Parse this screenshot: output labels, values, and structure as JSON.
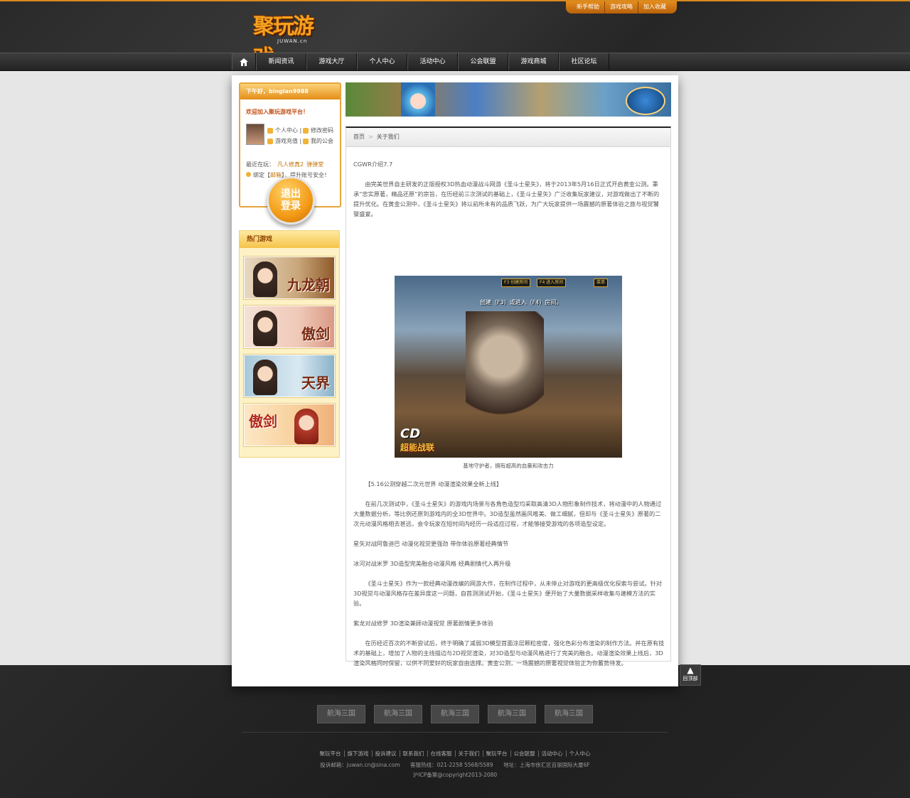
{
  "header": {
    "logo_text": "聚玩游戏",
    "logo_sub": "JUWAN.cn",
    "top_links": [
      "新手帮助",
      "游戏攻略",
      "加入收藏"
    ]
  },
  "nav": {
    "home_icon": "home-icon",
    "items": [
      "新闻资讯",
      "游戏大厅",
      "个人中心",
      "活动中心",
      "公会联盟",
      "游戏商城",
      "社区论坛"
    ]
  },
  "userbox": {
    "greeting": "下午好，binglan9988",
    "welcome": "欢迎加入聚玩游戏平台！",
    "links": [
      "个人中心",
      "修改密码",
      "游戏充值",
      "我的公会"
    ],
    "recent_label": "最近在玩：",
    "recent_games": [
      "凡人修真2",
      "弹弹堂"
    ],
    "bind_prefix": "绑定【",
    "bind_mail": "邮箱",
    "bind_suffix": "】，提升账号安全！",
    "logout_line1": "退出",
    "logout_line2": "登录"
  },
  "hotgames": {
    "title": "热门游戏",
    "games": [
      "九龙朝",
      "傲剑",
      "天界",
      "傲剑"
    ]
  },
  "breadcrumb": {
    "home": "首页",
    "current": "关于我们"
  },
  "article": {
    "p1": "CGWR介绍7.7",
    "p2": "由完美世界自主研发的正版授权3D热血动漫战斗网游《圣斗士星矢》，将于2013年5月16日正式开启黄金公测。秉承“忠实原著，精品还原”的宗旨，在历经前三次测试的基础上，《圣斗士星矢》广泛收集玩家建议，对游戏做出了不断的提升优化。在黄金公测中，《圣斗士星矢》将以前所未有的品质飞跃，为广大玩家提供一场震撼的原著体验之旅与视觉饕餮盛宴。",
    "screenshot_prompt": "创建（F3）或进入（F4）房间。",
    "screenshot_hud": [
      "F3 创建房间",
      "F4 进入房间",
      "菜单"
    ],
    "screenshot_logo_cd": "CD",
    "screenshot_logo_cn": "超能战联",
    "caption": "基地守护者，拥有超高的血量和攻击力",
    "p3": "【5.16公测穿越二次元世界 动漫渲染效果全新上线】",
    "p4": "在前几次测试中，《圣斗士星矢》的游戏内场景与各角色造型均采取高清3D人物形象制作技术，将动漫中的人物通过大量数据分析，等比例还原到游戏内的全3D世界中。3D造型虽然画风唯美、做工细腻，但却与《圣斗士星矢》原著的二次元动漫风格相去甚远，会令玩家在短时间内经历一段适应过程，才能够接受游戏的各项造型设定。",
    "p5": "星矢对战阿鲁迪巴 动漫化视觉更强劲 带你体验原著经典情节",
    "p6": "冰河对战米罗 3D造型完美融合动漫风格 经典剧情代入再升级",
    "p7": "《圣斗士星矢》作为一款经典动漫改编的网游大作，在制作过程中，从未停止对游戏的更高级优化探索与尝试。针对3D视觉与动漫风格存在差异度这一问题，自首测测试开始，《圣斗士星矢》便开始了大量数据采样收集与建模方法的实验。",
    "p8": "紫龙对战修罗 3D渲染兼顾动漫视觉 原著剧情更多体验",
    "p9": "在历经近百次的不断尝试后，终于明确了减弱3D模型首面涂层颗粒密度，强化色彩分布渲染的制作方法。并在原有技术的基础上，增加了人物的主线描边与2D视觉渲染，对3D造型与动漫风格进行了完美的融合。动漫渲染效果上线后，3D渲染风格同时保留，以供不同爱好的玩家自由选择。黄金公测，一场震撼的原著视觉体验正为你蓄势待发。"
  },
  "backtop": {
    "label": "回顶部"
  },
  "footer": {
    "games": [
      "航海三国",
      "航海三国",
      "航海三国",
      "航海三国",
      "航海三国"
    ],
    "links": [
      "聚玩平台",
      "旗下游戏",
      "投诉建议",
      "联系我们",
      "在线客服",
      "关于我们",
      "聚玩平台",
      "公会联盟",
      "活动中心",
      "个人中心"
    ],
    "email": "投诉邮箱：juwan.cn@sina.com",
    "phone": "客服热线：021-2258 5568/5589",
    "address": "地址：上海市徐汇区百丽国际大厦6F",
    "icp": "沪ICP备案@copyright2013-2080"
  },
  "colors": {
    "accent": "#e38b1b",
    "link": "#c07000",
    "dark": "#2a2a2a"
  }
}
